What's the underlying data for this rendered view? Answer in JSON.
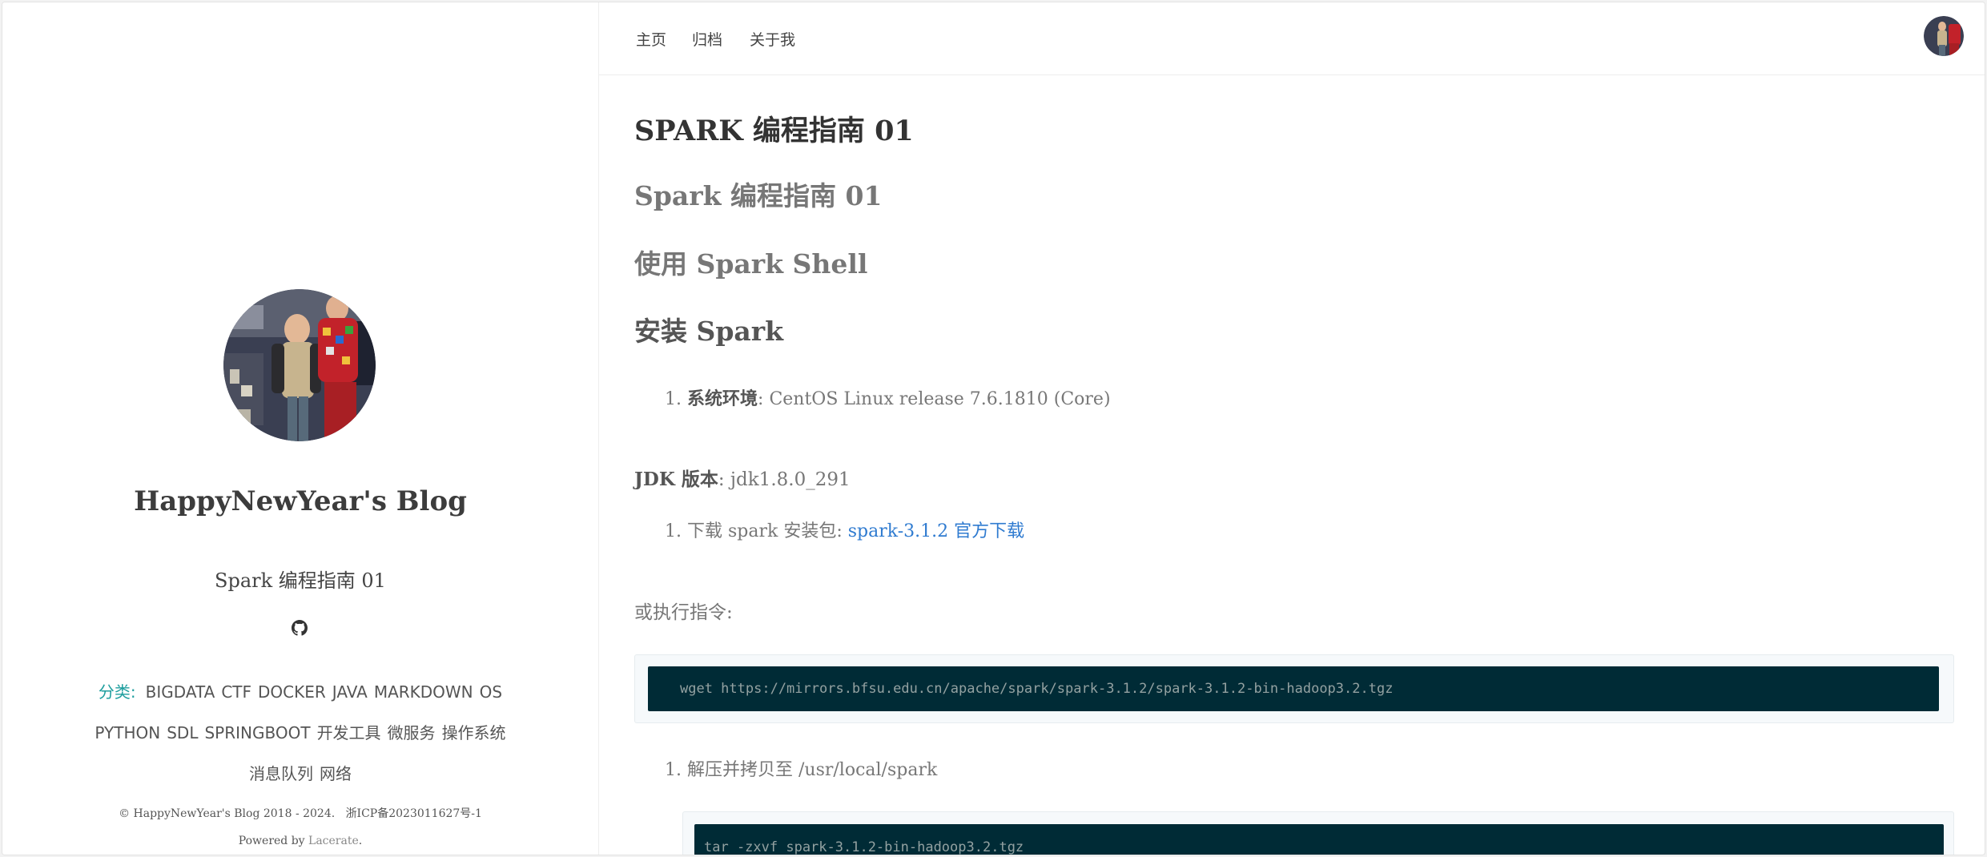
{
  "sidebar": {
    "blog_title": "HappyNewYear's Blog",
    "subtitle": "Spark 编程指南 01",
    "categories_label": "分类:",
    "categories": [
      "BIGDATA",
      "CTF",
      "DOCKER",
      "JAVA",
      "MARKDOWN",
      "OS",
      "PYTHON",
      "SDL",
      "SPRINGBOOT",
      "开发工具",
      "微服务",
      "操作系统",
      "消息队列",
      "网络"
    ],
    "copyright": "© HappyNewYear's Blog 2018 - 2024.",
    "icp": "浙ICP备2023011627号-1",
    "powered_prefix": "Powered by",
    "powered_link": "Lacerate",
    "powered_suffix": "."
  },
  "nav": {
    "items": [
      "主页",
      "归档",
      "关于我"
    ]
  },
  "article": {
    "h1": "SPARK 编程指南 01",
    "h2": "Spark 编程指南 01",
    "h3": "使用 Spark Shell",
    "h4": "安装 Spark",
    "item1_num": "1.",
    "item1_label": "系统环境",
    "item1_sep": ":",
    "item1_value": "CentOS Linux release 7.6.1810 (Core)",
    "jdk_label": "JDK 版本",
    "jdk_sep": ":",
    "jdk_value": "jdk1.8.0_291",
    "item2_num": "1.",
    "item2_text": "下载 spark 安装包:",
    "item2_link": "spark-3.1.2 官方下载",
    "or_exec": "或执行指令:",
    "code1": "wget https://mirrors.bfsu.edu.cn/apache/spark/spark-3.1.2/spark-3.1.2-bin-hadoop3.2.tgz",
    "item3_num": "1.",
    "item3_text": "解压并拷贝至 /usr/local/spark",
    "code2": "tar -zxvf spark-3.1.2-bin-hadoop3.2.tgz"
  },
  "colors": {
    "accent": "#1e9e9e",
    "link": "#2f7bd0",
    "code_bg": "#002b36"
  }
}
